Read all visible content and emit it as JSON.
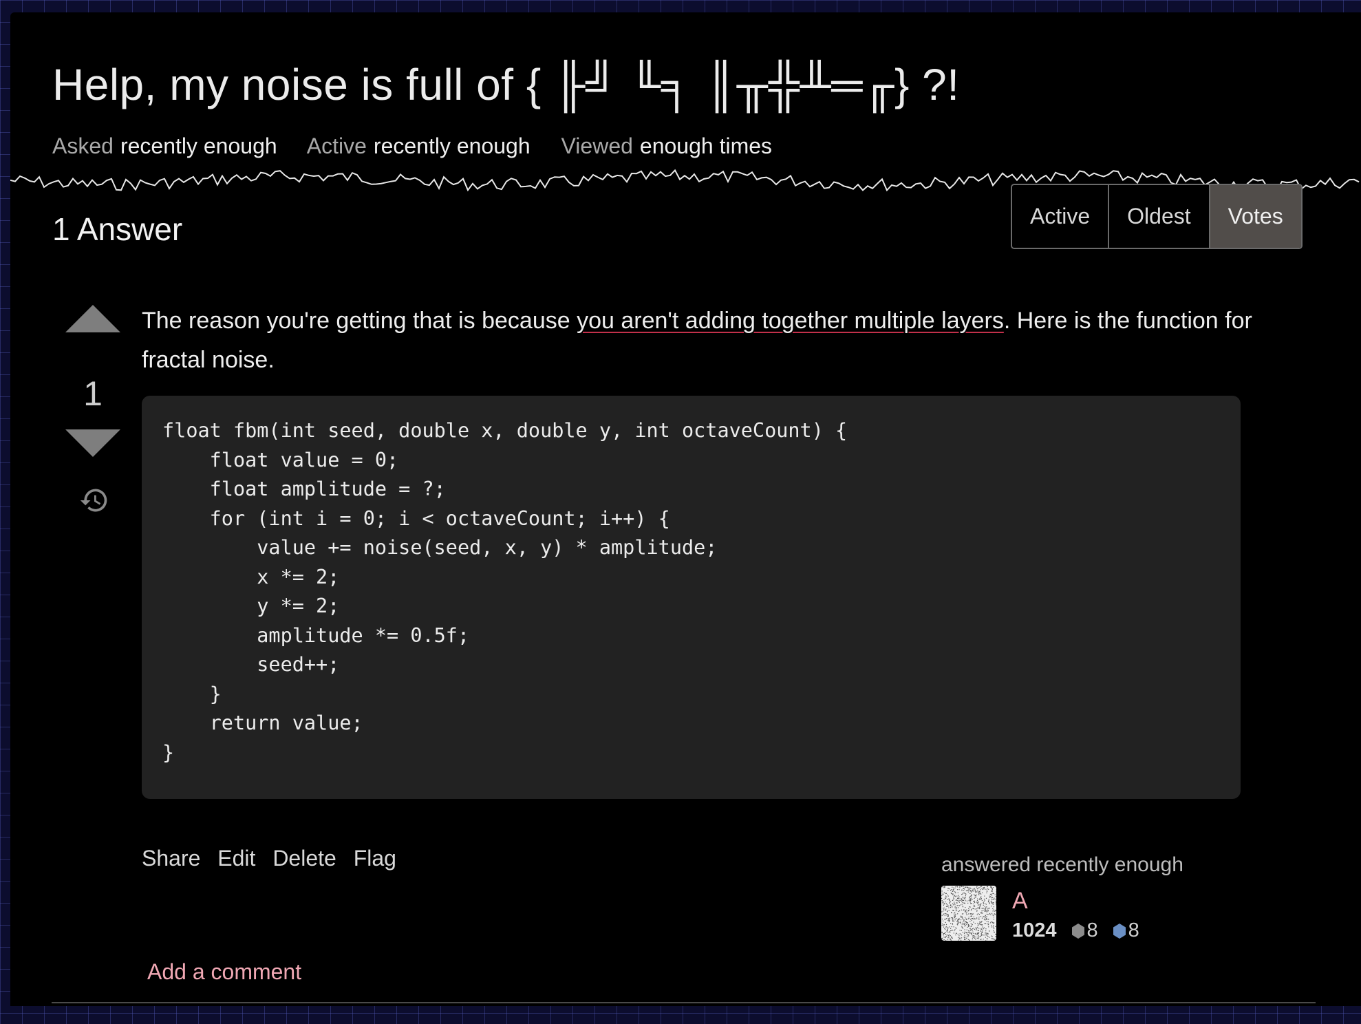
{
  "question": {
    "title": "Help, my noise is full of { ╟╝ ╙╕ ║╥╬╨═╓} ?!",
    "meta": [
      {
        "label": "Asked",
        "value": "recently enough"
      },
      {
        "label": "Active",
        "value": "recently enough"
      },
      {
        "label": "Viewed",
        "value": "enough times"
      }
    ]
  },
  "answers_header": {
    "count_label": "1 Answer",
    "sort_options": [
      "Active",
      "Oldest",
      "Votes"
    ],
    "selected_sort": "Votes"
  },
  "answer": {
    "score": "1",
    "text_before": "The reason you're getting that is because ",
    "text_link": "you aren't adding together multiple layers",
    "text_after": ". Here is the function for fractal noise.",
    "code": "float fbm(int seed, double x, double y, int octaveCount) {\n    float value = 0;\n    float amplitude = ?;\n    for (int i = 0; i < octaveCount; i++) {\n        value += noise(seed, x, y) * amplitude;\n        x *= 2;\n        y *= 2;\n        amplitude *= 0.5f;\n        seed++;\n    }\n    return value;\n}",
    "actions": [
      "Share",
      "Edit",
      "Delete",
      "Flag"
    ],
    "answered_label": "answered recently enough",
    "user": {
      "name": "A",
      "reputation": "1024",
      "silver_badges": "8",
      "bronze_badges": "8"
    },
    "add_comment": "Add a comment"
  },
  "colors": {
    "accent_pink": "#f0a8b4",
    "selected_sort_bg": "#514d4a",
    "link_underline": "#c2304a",
    "silver_badge": "#8c8c8c",
    "bronze_badge": "#6a8fc4"
  },
  "icons": [
    "upvote-arrow-icon",
    "downvote-arrow-icon",
    "history-icon",
    "silver-badge-icon",
    "bronze-badge-icon"
  ]
}
